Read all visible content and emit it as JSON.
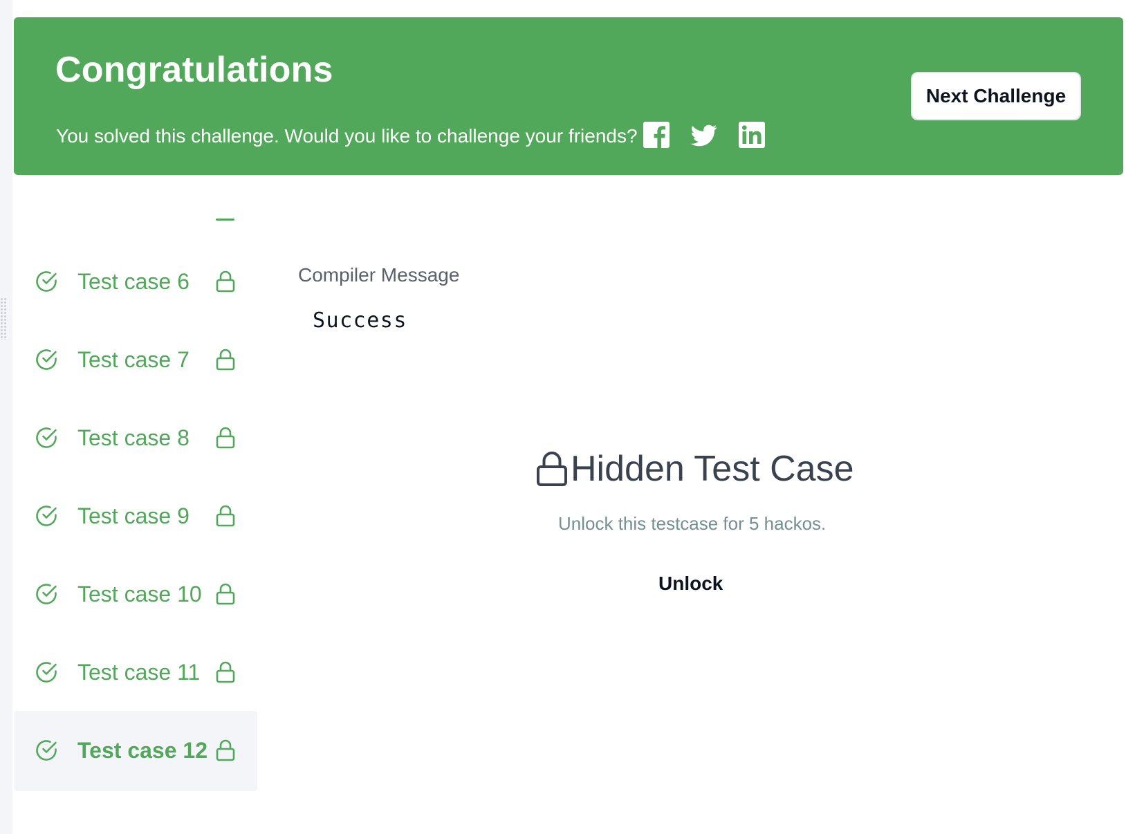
{
  "banner": {
    "title": "Congratulations",
    "subtitle": "You solved this challenge. Would you like to challenge your friends?",
    "share_icons": [
      "facebook-icon",
      "twitter-icon",
      "linkedin-icon"
    ],
    "next_button_label": "Next Challenge",
    "background_color": "#52a85a"
  },
  "test_cases": {
    "items": [
      {
        "label": "Test case 6",
        "status": "passed",
        "locked": true,
        "active": false
      },
      {
        "label": "Test case 7",
        "status": "passed",
        "locked": true,
        "active": false
      },
      {
        "label": "Test case 8",
        "status": "passed",
        "locked": true,
        "active": false
      },
      {
        "label": "Test case 9",
        "status": "passed",
        "locked": true,
        "active": false
      },
      {
        "label": "Test case 10",
        "status": "passed",
        "locked": true,
        "active": false
      },
      {
        "label": "Test case 11",
        "status": "passed",
        "locked": true,
        "active": false
      },
      {
        "label": "Test case 12",
        "status": "passed",
        "locked": true,
        "active": true
      }
    ],
    "accent_color": "#52a85a"
  },
  "output": {
    "compiler_label": "Compiler Message",
    "compiler_message": "Success",
    "hidden_title": "Hidden Test Case",
    "unlock_note": "Unlock this testcase for 5 hackos.",
    "unlock_label": "Unlock"
  }
}
